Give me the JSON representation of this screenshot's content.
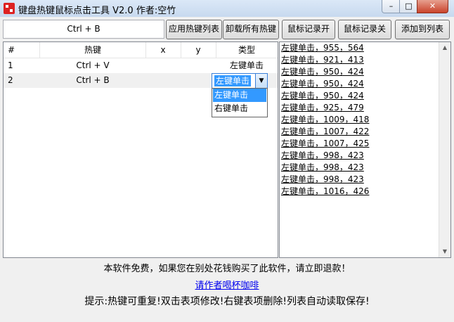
{
  "window": {
    "title": "键盘热键鼠标点击工具 V2.0 作者:空竹",
    "minimize": "–",
    "maximize": "□",
    "close": "✕"
  },
  "hotkey_input": {
    "value": "Ctrl + B"
  },
  "buttons": {
    "apply_hotkeys": "应用热键列表",
    "unload_hotkeys": "卸载所有热键",
    "record_on": "鼠标记录开",
    "record_off": "鼠标记录关",
    "add_to_list": "添加到列表"
  },
  "table": {
    "headers": [
      "#",
      "热键",
      "x",
      "y",
      "类型"
    ],
    "rows": [
      {
        "index": "1",
        "hotkey": "Ctrl + V",
        "x": "",
        "y": "",
        "type": "左键单击"
      },
      {
        "index": "2",
        "hotkey": "Ctrl + B",
        "x": "",
        "y": "",
        "type": "左键单击"
      }
    ]
  },
  "type_select": {
    "selected": "左键单击",
    "arrow": "▼",
    "options": [
      "左键单击",
      "右键单击"
    ]
  },
  "log": {
    "entries": [
      "左键单击，955，564",
      "左键单击，921，413",
      "左键单击，950，424",
      "左键单击，950，424",
      "左键单击，950，424",
      "左键单击，925，479",
      "左键单击，1009，418",
      "左键单击，1007，422",
      "左键单击，1007，425",
      "左键单击，998，423",
      "左键单击，998，423",
      "左键单击，998，423",
      "左键单击，1016，426"
    ],
    "scroll_up": "▲",
    "scroll_down": "▼"
  },
  "footer": {
    "notice": "本软件免费，如果您在别处花钱购买了此软件，请立即退款！",
    "coffee_link": "请作者喝杯咖啡",
    "tip": "提示:热键可重复!双击表项修改!右键表项删除!列表自动读取保存!"
  }
}
